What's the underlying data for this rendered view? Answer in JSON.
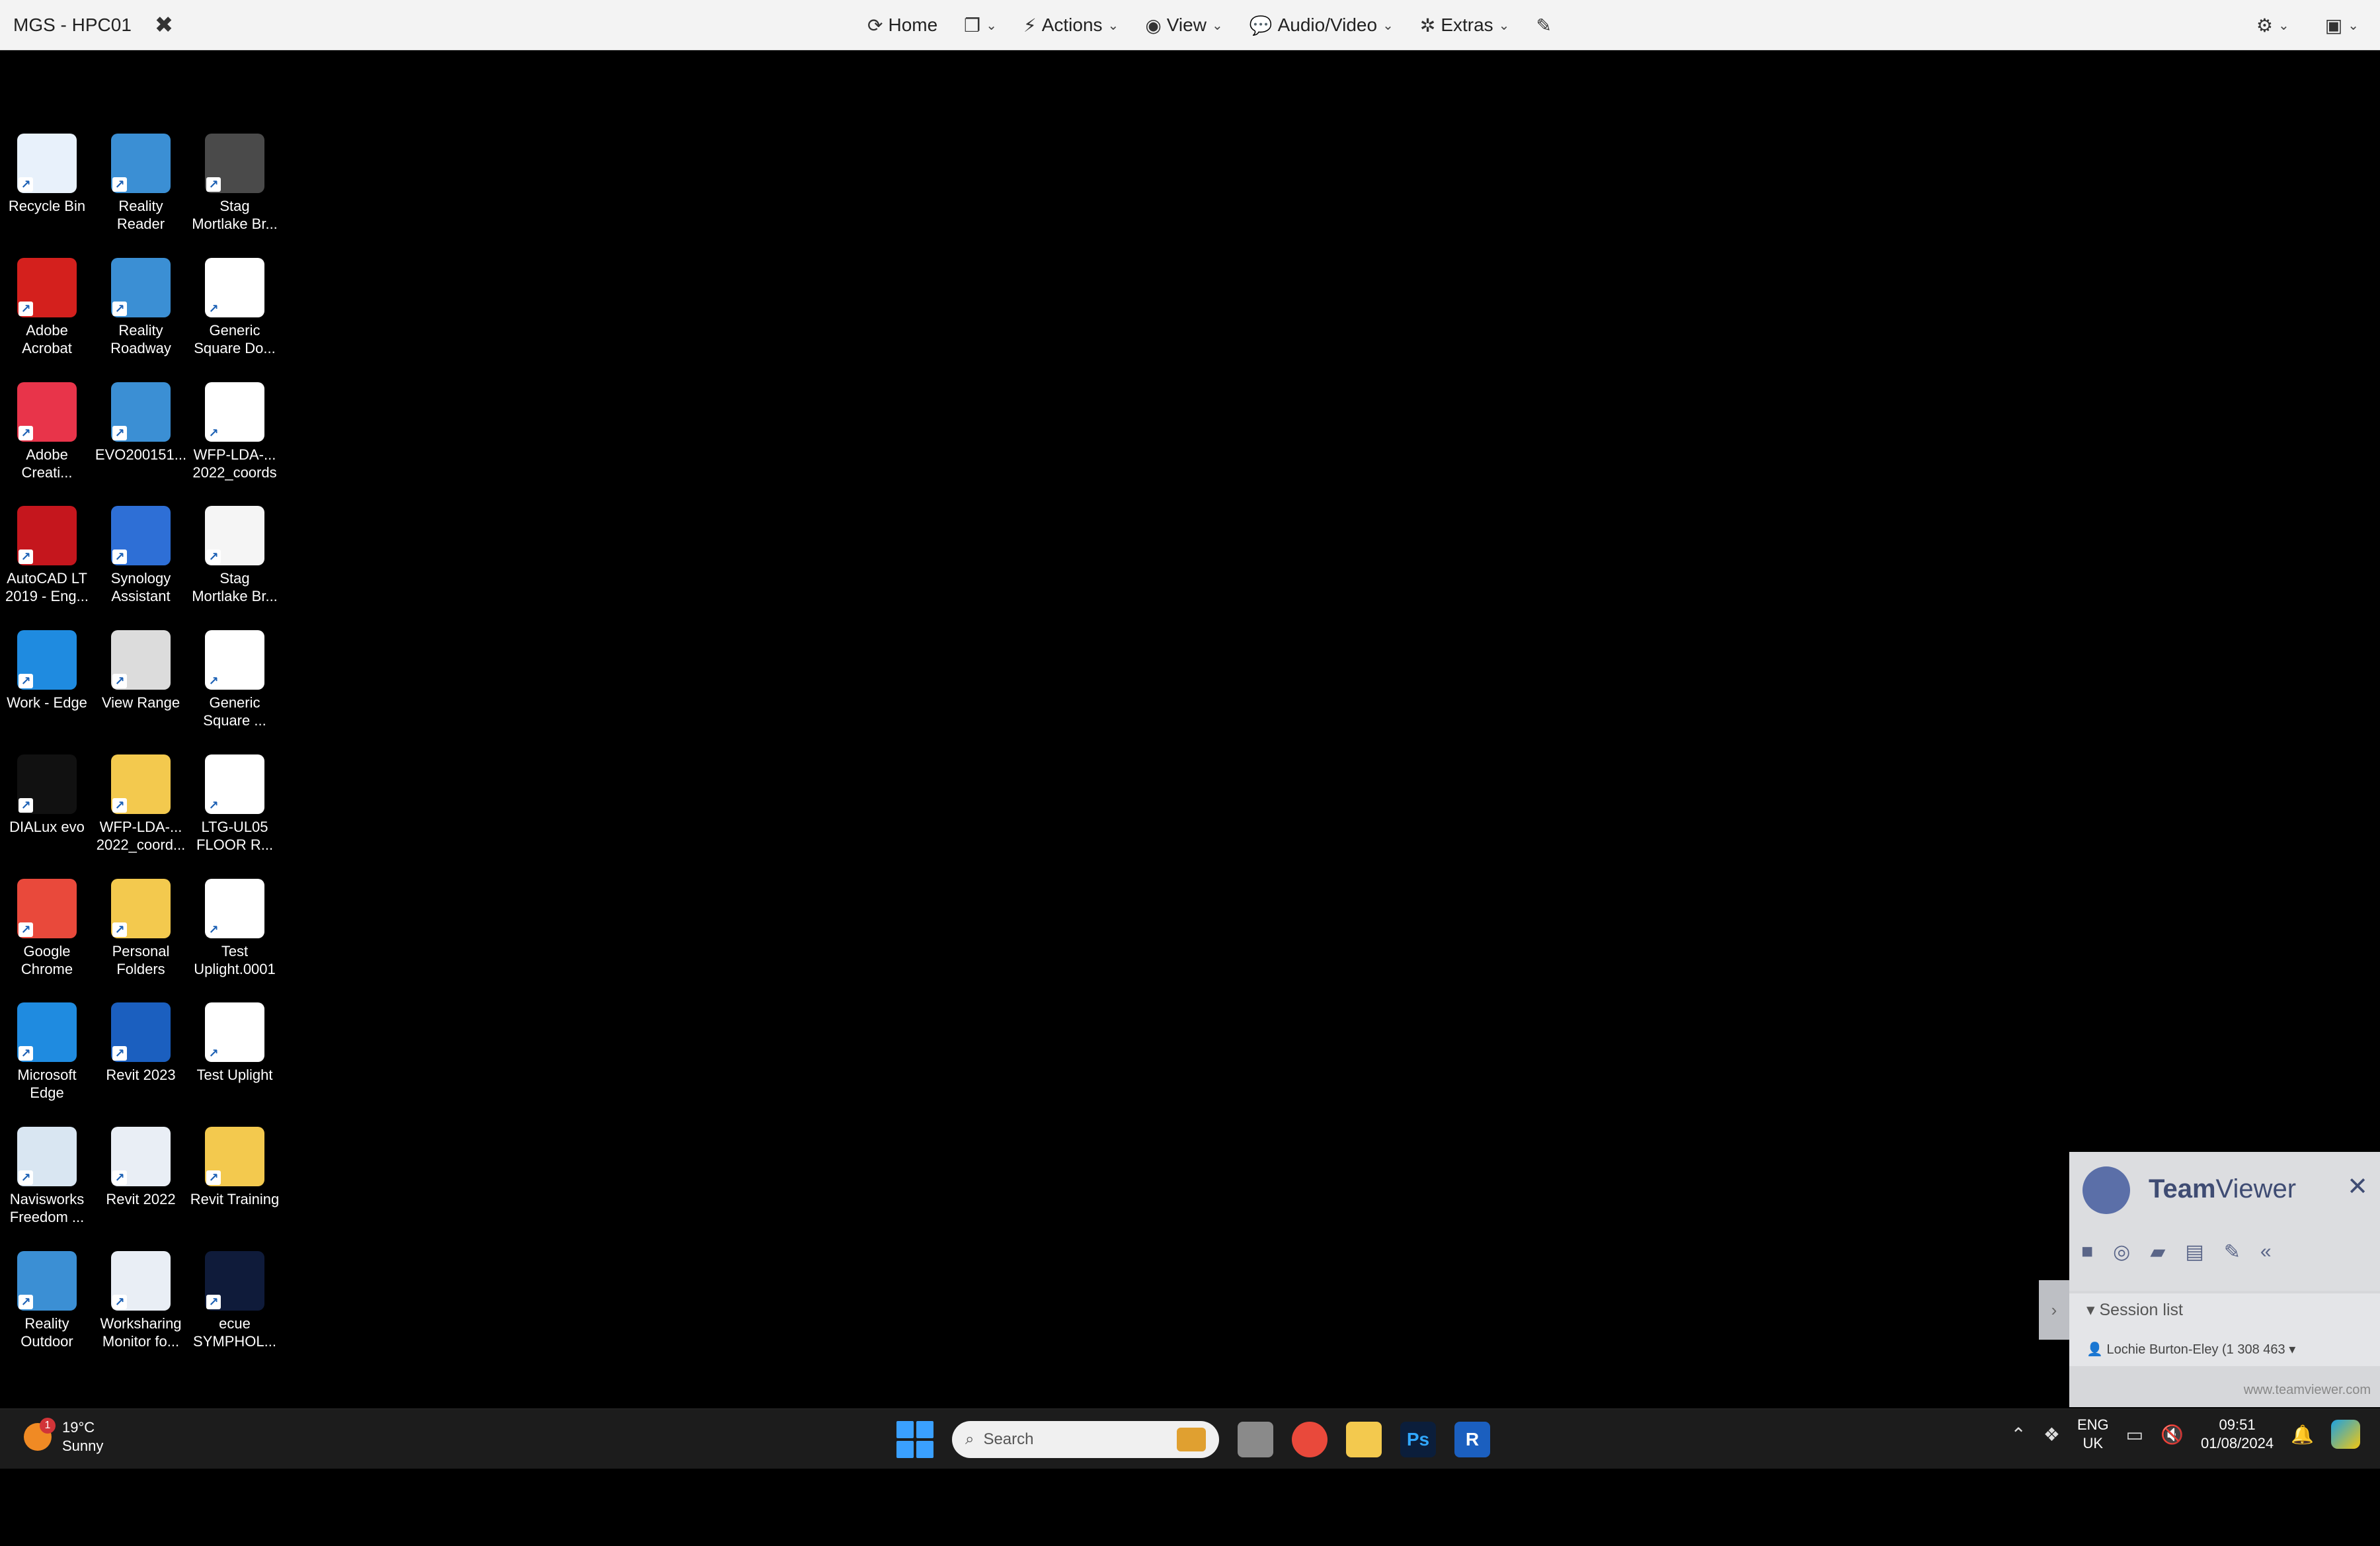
{
  "toolbar": {
    "title": "MGS - HPC01",
    "buttons": [
      {
        "label": "Home",
        "icon": "home-icon"
      },
      {
        "label": "",
        "icon": "files-icon"
      },
      {
        "label": "Actions",
        "icon": "lightning-icon"
      },
      {
        "label": "View",
        "icon": "eye-icon"
      },
      {
        "label": "Audio/Video",
        "icon": "chat-icon"
      },
      {
        "label": "Extras",
        "icon": "tools-icon"
      }
    ]
  },
  "desktop_icons": [
    {
      "label": "Recycle Bin",
      "color": "#e8f1fb"
    },
    {
      "label": "Reality\nReader",
      "color": "#3b8fd4"
    },
    {
      "label": "Stag\nMortlake Br...",
      "color": "#4a4a4a"
    },
    {
      "label": "Adobe\nAcrobat",
      "color": "#d4201d"
    },
    {
      "label": "Reality\nRoadway",
      "color": "#3b8fd4"
    },
    {
      "label": "Generic\nSquare Do...",
      "color": "#ffffff"
    },
    {
      "label": "Adobe\nCreati...",
      "color": "#e8344a"
    },
    {
      "label": "EVO200151...",
      "color": "#3b8fd4"
    },
    {
      "label": "WFP-LDA-...\n2022_coords",
      "color": "#ffffff"
    },
    {
      "label": "AutoCAD LT\n2019 - Eng...",
      "color": "#c5161d"
    },
    {
      "label": "Synology\nAssistant",
      "color": "#2e6fd6"
    },
    {
      "label": "Stag\nMortlake Br...",
      "color": "#f5f5f5"
    },
    {
      "label": "Work - Edge",
      "color": "#1f8be0"
    },
    {
      "label": "View Range",
      "color": "#dcdcdc"
    },
    {
      "label": "Generic\nSquare ...",
      "color": "#ffffff"
    },
    {
      "label": "DIALux evo",
      "color": "#111111"
    },
    {
      "label": "WFP-LDA-...\n2022_coord...",
      "color": "#f3c94e"
    },
    {
      "label": "LTG-UL05\nFLOOR R...",
      "color": "#ffffff"
    },
    {
      "label": "Google\nChrome",
      "color": "#e9493b"
    },
    {
      "label": "Personal\nFolders",
      "color": "#f3c94e"
    },
    {
      "label": "Test\nUplight.0001",
      "color": "#ffffff"
    },
    {
      "label": "Microsoft\nEdge",
      "color": "#1f8be0"
    },
    {
      "label": "Revit 2023",
      "color": "#1b5fbf"
    },
    {
      "label": "Test Uplight",
      "color": "#ffffff"
    },
    {
      "label": "Navisworks\nFreedom ...",
      "color": "#d9e6f2"
    },
    {
      "label": "Revit 2022",
      "color": "#e9eef5"
    },
    {
      "label": "Revit Training",
      "color": "#f3c94e"
    },
    {
      "label": "Reality\nOutdoor",
      "color": "#3b8fd4"
    },
    {
      "label": "Worksharing\nMonitor fo...",
      "color": "#e9eef5"
    },
    {
      "label": "ecue\nSYMPHOL...",
      "color": "#0f1b3a"
    }
  ],
  "teamviewer": {
    "brand_bold": "Team",
    "brand_rest": "Viewer",
    "session_title": "Session list",
    "session_entry": "Lochie Burton-Eley (1 308 463",
    "website": "www.teamviewer.com"
  },
  "taskbar": {
    "weather_temp": "19°C",
    "weather_desc": "Sunny",
    "weather_badge": "1",
    "search_placeholder": "Search",
    "lang_top": "ENG",
    "lang_bottom": "UK",
    "time": "09:51",
    "date": "01/08/2024"
  }
}
